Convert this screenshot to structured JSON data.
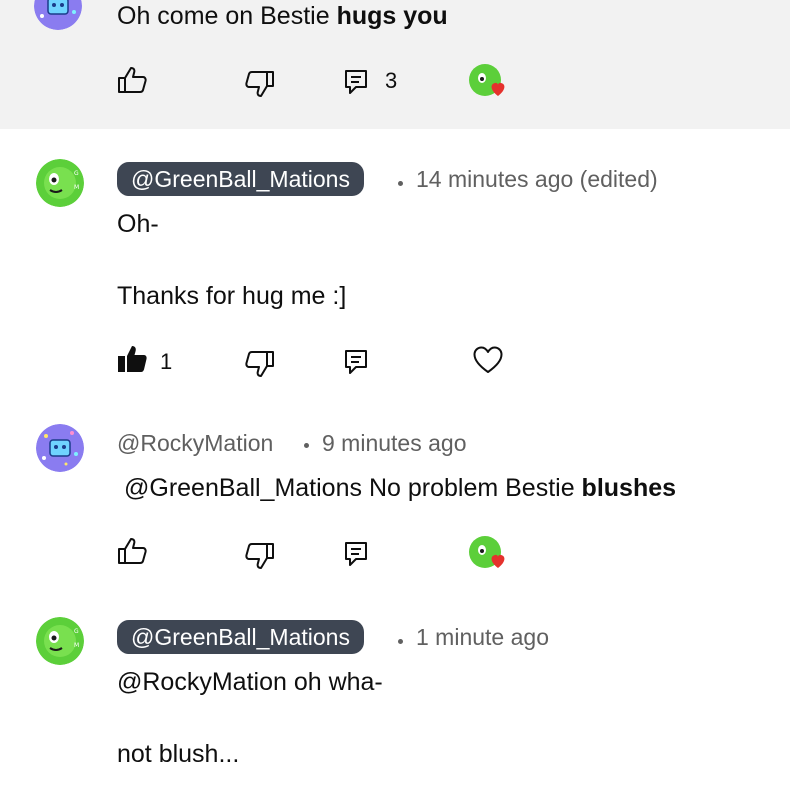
{
  "comments": [
    {
      "text_plain": "Oh come on Bestie ",
      "text_bold": "hugs you",
      "reply_count": "3",
      "icons": [
        "thumbs-up-outline",
        "thumbs-down-outline",
        "reply",
        "creator-heart"
      ]
    },
    {
      "author": "@GreenBall_Mations",
      "timestamp": "14 minutes ago (edited)",
      "text_line1": "Oh-",
      "text_line2": "Thanks for hug me :]",
      "like_count": "1",
      "icons": [
        "thumbs-up-filled",
        "thumbs-down-outline",
        "reply",
        "heart-outline"
      ]
    },
    {
      "author": "@RockyMation",
      "timestamp": "9 minutes ago",
      "mention": "@GreenBall_Mations",
      "text_plain": " No problem Bestie ",
      "text_bold": "blushes",
      "icons": [
        "thumbs-up-outline",
        "thumbs-down-outline",
        "reply",
        "creator-heart"
      ]
    },
    {
      "author": "@GreenBall_Mations",
      "timestamp": "1 minute ago",
      "text_line1": "@RockyMation oh wha-",
      "text_line2": "not blush..."
    }
  ],
  "colors": {
    "author_pill": "#3e4653",
    "highlight_band": "#f2f2f2",
    "heart_red": "#e5322d",
    "green_avatar": "#5ccf3a",
    "purple_avatar": "#8a7cf0"
  }
}
